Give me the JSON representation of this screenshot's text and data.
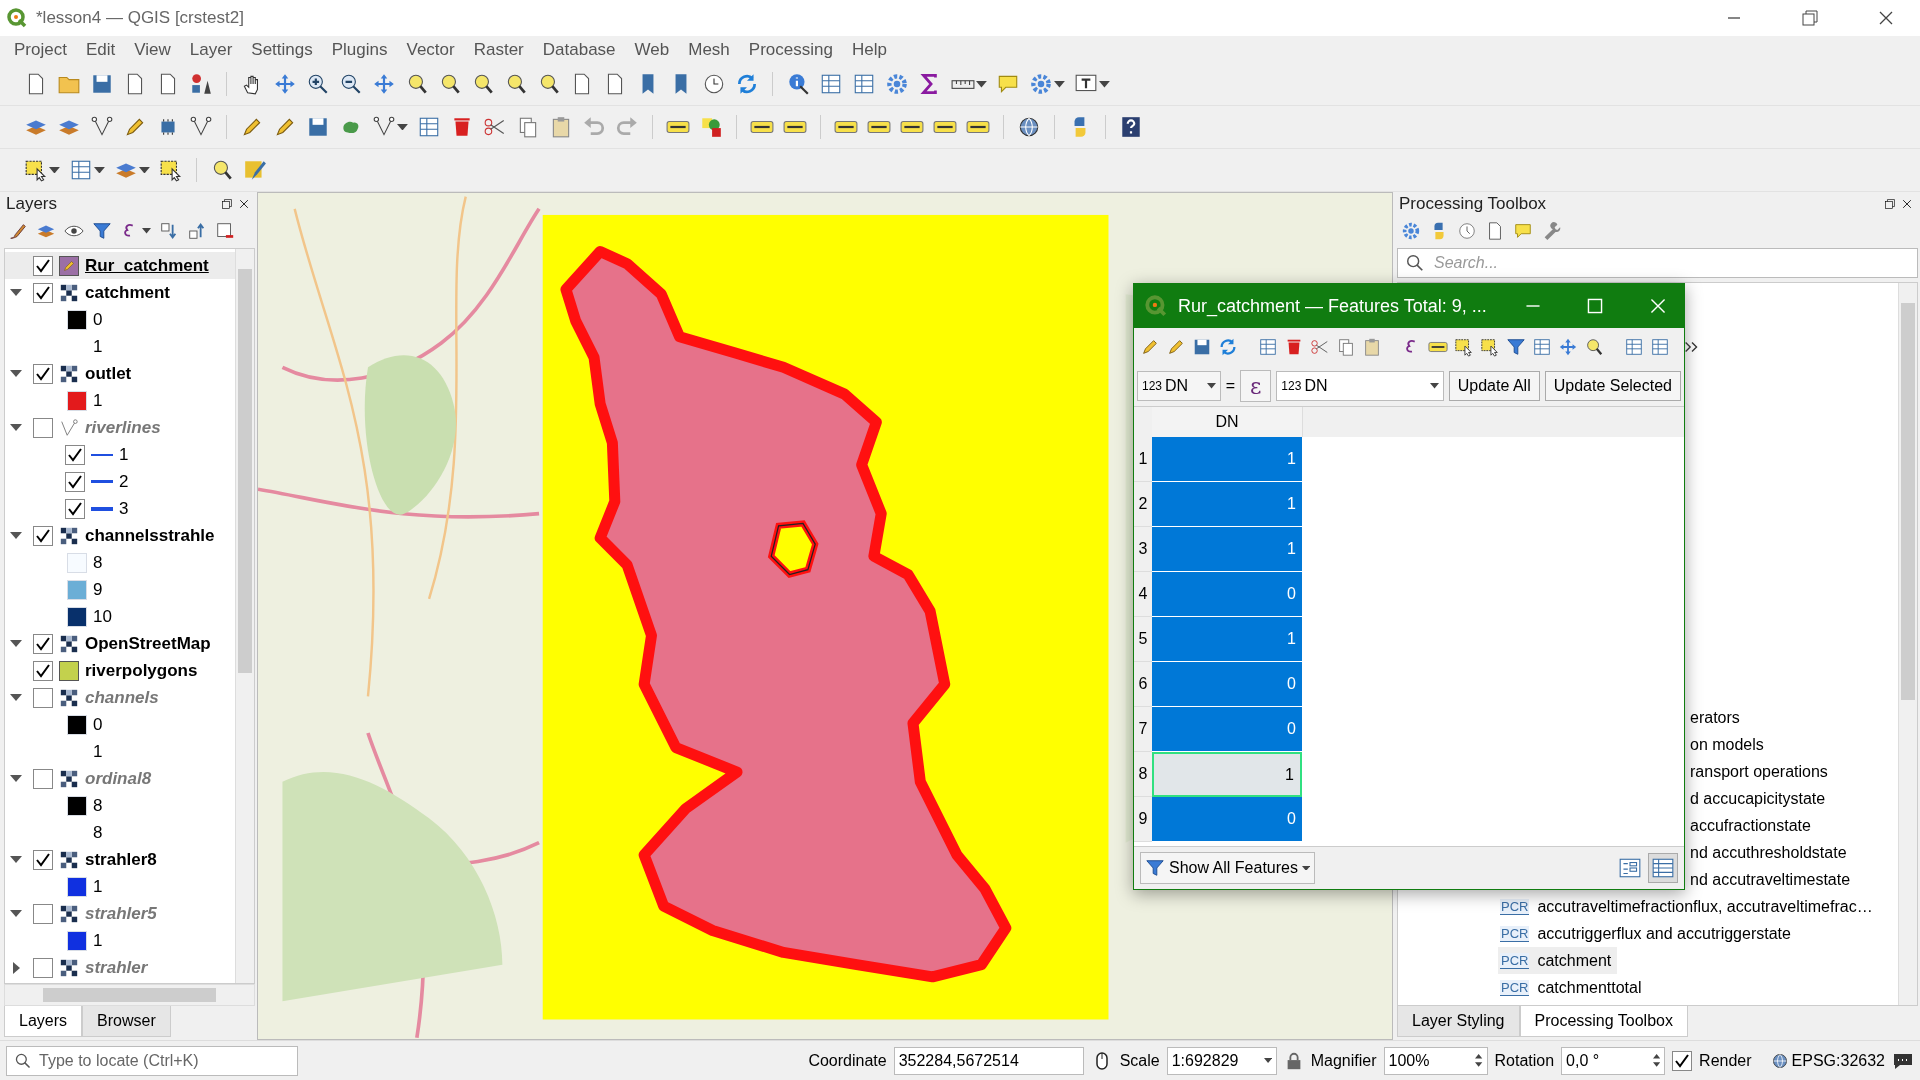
{
  "window": {
    "title": "*lesson4 — QGIS [crstest2]"
  },
  "menu": [
    "Project",
    "Edit",
    "View",
    "Layer",
    "Settings",
    "Plugins",
    "Vector",
    "Raster",
    "Database",
    "Web",
    "Mesh",
    "Processing",
    "Help"
  ],
  "layers_panel": {
    "title": "Layers",
    "layers": [
      {
        "name": "Rur_catchment",
        "kind": "polygon",
        "color": "#9b6fa5",
        "checked": true,
        "selected": true
      },
      {
        "name": "catchment",
        "kind": "raster",
        "checked": true,
        "selected": false,
        "expanded": true,
        "legend": [
          {
            "kind": "swatch",
            "label": "0",
            "color": "#000000"
          },
          {
            "kind": "blank",
            "label": "1"
          }
        ]
      },
      {
        "name": "outlet",
        "kind": "raster",
        "checked": true,
        "selected": false,
        "expanded": true,
        "legend": [
          {
            "kind": "swatch",
            "label": "1",
            "color": "#e31a1c"
          }
        ]
      },
      {
        "name": "riverlines",
        "kind": "line",
        "checked": false,
        "selected": false,
        "expanded": true,
        "legend": [
          {
            "kind": "line",
            "label": "1",
            "color": "#1f4fe0",
            "checked": true
          },
          {
            "kind": "line",
            "label": "2",
            "color": "#1f4fe0",
            "checked": true
          },
          {
            "kind": "line",
            "label": "3",
            "color": "#1f4fe0",
            "checked": true
          }
        ]
      },
      {
        "name": "channelsstrahle",
        "kind": "raster",
        "checked": true,
        "selected": false,
        "expanded": true,
        "legend": [
          {
            "kind": "swatch",
            "label": "8",
            "color": "#f7fbff"
          },
          {
            "kind": "swatch",
            "label": "9",
            "color": "#6baed6"
          },
          {
            "kind": "swatch",
            "label": "10",
            "color": "#08306b"
          }
        ]
      },
      {
        "name": "OpenStreetMap",
        "kind": "raster",
        "checked": true,
        "selected": false,
        "expanded": true
      },
      {
        "name": "riverpolygons",
        "kind": "polygon",
        "color": "#c3d14d",
        "checked": true,
        "selected": false
      },
      {
        "name": "channels",
        "kind": "raster",
        "checked": false,
        "selected": false,
        "expanded": true,
        "legend": [
          {
            "kind": "swatch",
            "label": "0",
            "color": "#000000"
          },
          {
            "kind": "blank",
            "label": "1"
          }
        ]
      },
      {
        "name": "ordinal8",
        "kind": "raster",
        "checked": false,
        "selected": false,
        "expanded": true,
        "legend": [
          {
            "kind": "swatch",
            "label": "8",
            "color": "#000000"
          },
          {
            "kind": "blank",
            "label": "8"
          }
        ]
      },
      {
        "name": "strahler8",
        "kind": "raster",
        "checked": true,
        "selected": false,
        "expanded": true,
        "legend": [
          {
            "kind": "swatch",
            "label": "1",
            "color": "#1030e0"
          }
        ]
      },
      {
        "name": "strahler5",
        "kind": "raster",
        "checked": false,
        "selected": false,
        "expanded": true,
        "legend": [
          {
            "kind": "swatch",
            "label": "1",
            "color": "#1030e0"
          }
        ]
      },
      {
        "name": "strahler",
        "kind": "raster",
        "checked": false,
        "selected": false,
        "expanded": false
      }
    ],
    "tabs": [
      {
        "label": "Layers",
        "selected": true
      },
      {
        "label": "Browser",
        "selected": false
      }
    ]
  },
  "processing_panel": {
    "title": "Processing Toolbox",
    "search": {
      "placeholder": "Search..."
    },
    "items": [
      {
        "kind": "covered",
        "label": "erators",
        "selected": false
      },
      {
        "kind": "covered",
        "label": "on models",
        "selected": false
      },
      {
        "kind": "covered",
        "label": "ransport operations",
        "selected": false
      },
      {
        "kind": "covered",
        "label": "d accucapicitystate",
        "selected": false
      },
      {
        "kind": "covered",
        "label": "accufractionstate",
        "selected": false
      },
      {
        "kind": "covered",
        "label": "nd accuthresholdstate",
        "selected": false
      },
      {
        "kind": "covered",
        "label": "nd accutraveltimestate",
        "selected": false
      },
      {
        "kind": "algorithm",
        "badge": "PCR",
        "label": "accutraveltimefractionflux, accutraveltimefrac…",
        "selected": false
      },
      {
        "kind": "algorithm",
        "badge": "PCR",
        "label": "accutriggerflux and accutriggerstate",
        "selected": false
      },
      {
        "kind": "algorithm",
        "badge": "PCR",
        "label": "catchment",
        "selected": true
      },
      {
        "kind": "algorithm",
        "badge": "PCR",
        "label": "catchmenttotal",
        "selected": false
      }
    ],
    "tabs": [
      {
        "label": "Layer Styling",
        "selected": false
      },
      {
        "label": "Processing Toolbox",
        "selected": true
      }
    ]
  },
  "attribute_table": {
    "title": "Rur_catchment — Features Total: 9, ...",
    "field_combo": {
      "type": "123",
      "value": "DN"
    },
    "operator": "=",
    "expression_button": "ε",
    "value_combo": {
      "type": "123",
      "value": "DN"
    },
    "buttons": [
      "Update All",
      "Update Selected"
    ],
    "columns": [
      "DN"
    ],
    "rows": [
      {
        "number": "1",
        "value": "1",
        "selected": true,
        "current": false
      },
      {
        "number": "2",
        "value": "1",
        "selected": true,
        "current": false
      },
      {
        "number": "3",
        "value": "1",
        "selected": true,
        "current": false
      },
      {
        "number": "4",
        "value": "0",
        "selected": true,
        "current": false
      },
      {
        "number": "5",
        "value": "1",
        "selected": true,
        "current": false
      },
      {
        "number": "6",
        "value": "0",
        "selected": true,
        "current": false
      },
      {
        "number": "7",
        "value": "0",
        "selected": true,
        "current": false
      },
      {
        "number": "8",
        "value": "1",
        "selected": false,
        "current": true
      },
      {
        "number": "9",
        "value": "0",
        "selected": true,
        "current": false
      }
    ],
    "filter_button": "Show All Features"
  },
  "status_bar": {
    "locator": {
      "placeholder": "Type to locate (Ctrl+K)"
    },
    "coordinate": {
      "label": "Coordinate",
      "value": "352284,5672514"
    },
    "scale": {
      "label": "Scale",
      "value": "1:692829"
    },
    "magnifier": {
      "label": "Magnifier",
      "value": "100%"
    },
    "rotation": {
      "label": "Rotation",
      "value": "0,0 °"
    },
    "render": {
      "label": "Render",
      "checked": true
    },
    "crs": "EPSG:32632"
  }
}
